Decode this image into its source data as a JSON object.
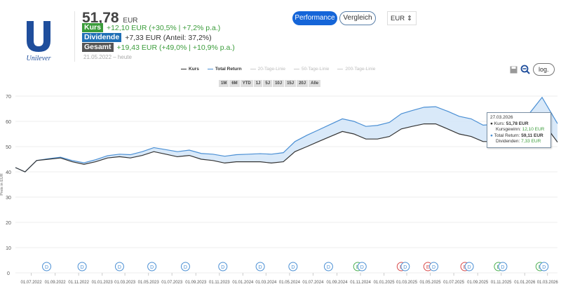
{
  "header": {
    "logo_text": "Unilever",
    "price": "51,78",
    "currency": "EUR",
    "kurs_label": "Kurs",
    "kurs_value": "+12,10 EUR (+30,5% | +7,2% p.a.)",
    "dividende_label": "Dividende",
    "dividende_value": "+7,33 EUR (Anteil: 37,2%)",
    "gesamt_label": "Gesamt",
    "gesamt_value": "+19,43 EUR (+49,0% | +10,9% p.a.)",
    "range": "21.05.2022 – heute"
  },
  "controls": {
    "performance": "Performance",
    "vergleich": "Vergleich",
    "currency_select": "EUR",
    "log": "log."
  },
  "colors": {
    "kurs": "#333333",
    "total_return": "#4a8fd4",
    "area": "#cfe3f7",
    "green": "#3a9c3a",
    "blue": "#1f6fb5",
    "dark": "#555555",
    "dividend_marker": "#4a8fd4",
    "earnings_green": "#4caf50",
    "earnings_red": "#d84a4a"
  },
  "legend": [
    "Kurs",
    "Total Return",
    "20-Tage-Linie",
    "50-Tage-Linie",
    "200-Tage-Linie"
  ],
  "range_buttons": [
    "1M",
    "6M",
    "YTD",
    "1J",
    "5J",
    "10J",
    "15J",
    "20J",
    "Alle"
  ],
  "tooltip": {
    "date": "27.03.2026",
    "kurs_label": "Kurs: ",
    "kurs": "51,78 EUR",
    "gewinn_label": "Kursgewinn: ",
    "gewinn": "12,10 EUR",
    "tr_label": "Total Return: ",
    "tr": "59,11 EUR",
    "div_label": "Dividenden: ",
    "div": "7,33 EUR"
  },
  "chart_data": {
    "type": "line",
    "ylabel": "Preis in EUR",
    "ylim": [
      0,
      70
    ],
    "yticks": [
      0,
      10,
      20,
      30,
      40,
      50,
      60,
      70
    ],
    "grid": true,
    "xticks": [
      "01.07.2022",
      "01.09.2022",
      "01.11.2022",
      "01.01.2023",
      "01.03.2023",
      "01.05.2023",
      "01.07.2023",
      "01.09.2023",
      "01.11.2023",
      "01.01.2024",
      "01.03.2024",
      "01.05.2024",
      "01.07.2024",
      "01.09.2024",
      "01.11.2024",
      "01.01.2025",
      "01.03.2025",
      "01.05.2025",
      "01.07.2025",
      "01.09.2025",
      "01.11.2025",
      "01.01.2026",
      "01.03.2026"
    ],
    "x": [
      "2022-05-21",
      "2022-06-15",
      "2022-07-15",
      "2022-08-15",
      "2022-09-15",
      "2022-10-15",
      "2022-11-15",
      "2022-12-15",
      "2023-01-15",
      "2023-02-15",
      "2023-03-15",
      "2023-04-15",
      "2023-05-15",
      "2023-06-15",
      "2023-07-15",
      "2023-08-15",
      "2023-09-15",
      "2023-10-15",
      "2023-11-15",
      "2023-12-15",
      "2024-01-15",
      "2024-02-15",
      "2024-03-15",
      "2024-04-15",
      "2024-05-15",
      "2024-06-15",
      "2024-07-15",
      "2024-08-15",
      "2024-09-15",
      "2024-10-15",
      "2024-11-15",
      "2024-12-15",
      "2025-01-15",
      "2025-02-15",
      "2025-03-15",
      "2025-04-15",
      "2025-05-15",
      "2025-06-15",
      "2025-07-15",
      "2025-08-15",
      "2025-09-15",
      "2025-10-15",
      "2025-11-15",
      "2025-12-15",
      "2026-01-15",
      "2026-02-15",
      "2026-03-27"
    ],
    "series": [
      {
        "name": "Kurs",
        "values": [
          41.7,
          40,
          44.5,
          45,
          45.5,
          44,
          43,
          44,
          45.5,
          46,
          45.5,
          46.5,
          48,
          47,
          46,
          46.5,
          45,
          44.5,
          43.5,
          44,
          44,
          44,
          43.5,
          44,
          48,
          50,
          52,
          54,
          56,
          55,
          53,
          53,
          54,
          57,
          58,
          59,
          59,
          57,
          55,
          54,
          52,
          52,
          52,
          54,
          56,
          60,
          51.78
        ]
      },
      {
        "name": "Total Return",
        "values": [
          41.7,
          40,
          44.5,
          45.2,
          45.8,
          44.5,
          43.6,
          44.8,
          46.4,
          47,
          46.8,
          48,
          49.6,
          48.8,
          48,
          48.6,
          47.3,
          47,
          46.2,
          46.8,
          47,
          47.2,
          47,
          47.6,
          52,
          54.5,
          56.6,
          58.8,
          61,
          60,
          58,
          58.4,
          59.6,
          63,
          64.3,
          65.6,
          65.8,
          64,
          62,
          61,
          58.5,
          58.8,
          58.9,
          61.2,
          63.5,
          69.5,
          59.11
        ]
      }
    ],
    "events": [
      {
        "type": "D",
        "date": "2022-08-10"
      },
      {
        "type": "D",
        "date": "2022-11-10"
      },
      {
        "type": "D",
        "date": "2023-02-15"
      },
      {
        "type": "D",
        "date": "2023-05-10"
      },
      {
        "type": "D",
        "date": "2023-08-05"
      },
      {
        "type": "D",
        "date": "2023-11-10"
      },
      {
        "type": "D",
        "date": "2024-02-15"
      },
      {
        "type": "D",
        "date": "2024-05-10"
      },
      {
        "type": "D",
        "date": "2024-08-10"
      },
      {
        "type": "E",
        "color": "green",
        "date": "2024-10-25"
      },
      {
        "type": "D",
        "date": "2024-11-05"
      },
      {
        "type": "E",
        "color": "red",
        "date": "2025-02-15"
      },
      {
        "type": "D",
        "date": "2025-02-25"
      },
      {
        "type": "E",
        "color": "red",
        "date": "2025-04-25"
      },
      {
        "type": "D",
        "date": "2025-05-10"
      },
      {
        "type": "E",
        "color": "red",
        "date": "2025-07-30"
      },
      {
        "type": "D",
        "date": "2025-08-10"
      },
      {
        "type": "E",
        "color": "green",
        "date": "2025-10-25"
      },
      {
        "type": "D",
        "date": "2025-11-05"
      },
      {
        "type": "E",
        "color": "green",
        "date": "2026-02-10"
      },
      {
        "type": "D",
        "date": "2026-02-20"
      }
    ]
  }
}
